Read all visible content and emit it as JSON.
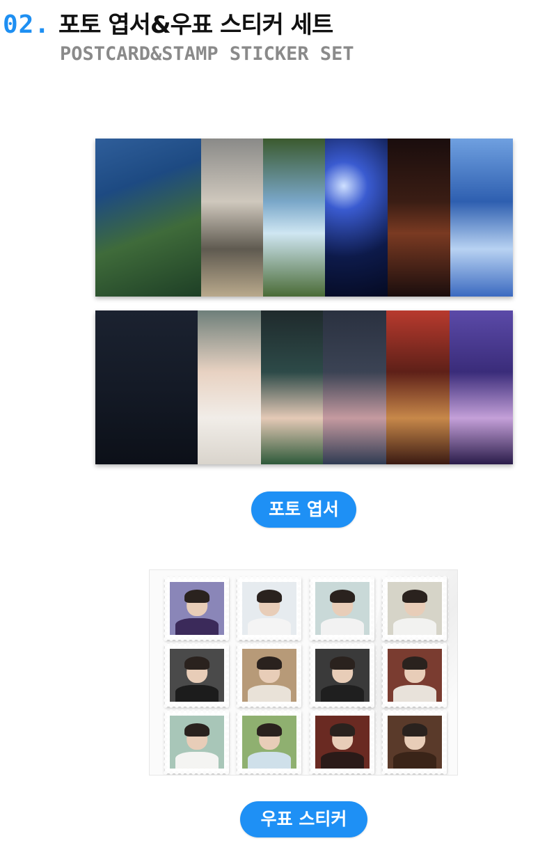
{
  "header": {
    "number": "02.",
    "title": "포토 엽서&우표 스티커 세트",
    "subtitle": "POSTCARD&STAMP STICKER SET"
  },
  "colors": {
    "accent": "#1e90f5",
    "number": "#1e8ff2",
    "subtitle": "#8a8a8a"
  },
  "postcards": {
    "row1": [
      {
        "name": "umbrella-school-photo",
        "bg": "linear-gradient(160deg,#2f5e9a 0%,#1d4a82 30%,#3f6b3a 60%,#1e3f26 100%)"
      },
      {
        "name": "two-students-photo",
        "bg": "linear-gradient(180deg,#8a8a88 0%,#cfc8bd 40%,#5f5a50 70%,#b9a98c 100%)"
      },
      {
        "name": "light-blue-jacket-photo",
        "bg": "linear-gradient(180deg,#3b5a2e 0%,#7aa7c9 40%,#cfe6f2 60%,#4a6b36 100%)"
      },
      {
        "name": "blue-stage-lights-photo",
        "bg": "radial-gradient(circle at 30% 30%,#cfe0ff 0%,#3a5bd0 20%,#0d1a4a 60%,#050a22 100%)"
      },
      {
        "name": "drum-stage-photo",
        "bg": "linear-gradient(180deg,#1a0d0d 0%,#3a1d14 40%,#7a3a22 60%,#1a0d0d 100%)"
      },
      {
        "name": "blue-guitar-photo",
        "bg": "linear-gradient(180deg,#6fa0e0 0%,#2e5fb0 40%,#b8d2f2 70%,#3b6ac0 100%)"
      }
    ],
    "row2": [
      {
        "name": "mic-stage-photo",
        "bg": "linear-gradient(180deg,#1b2230 0%,#141a26 50%,#0c1018 100%)"
      },
      {
        "name": "smiling-girl-photo",
        "bg": "linear-gradient(180deg,#6e7f7a 0%,#e8d2c2 40%,#f1ede8 70%,#d9d4cc 100%)"
      },
      {
        "name": "green-guitar-photo",
        "bg": "linear-gradient(180deg,#1f2a2c 0%,#2d4a48 40%,#e4c9b6 70%,#2e5a3a 100%)"
      },
      {
        "name": "pink-guitar-photo",
        "bg": "linear-gradient(180deg,#2a3140 0%,#3b4354 40%,#c59aa0 70%,#2f3b52 100%)"
      },
      {
        "name": "red-drums-photo",
        "bg": "linear-gradient(180deg,#b83a2e 0%,#5e2018 40%,#c7884a 70%,#3a1a12 100%)"
      },
      {
        "name": "purple-guitar-photo",
        "bg": "linear-gradient(180deg,#5b4aa8 0%,#3a2c7a 40%,#c4a0d8 70%,#2a1c4a 100%)"
      }
    ]
  },
  "pill_postcard": "포토 엽서",
  "stamps": [
    {
      "name": "stamp-1",
      "bg": "#8a86b8",
      "body": "#3b2a5a"
    },
    {
      "name": "stamp-2",
      "bg": "#e6ebef",
      "body": "#f4f4f4"
    },
    {
      "name": "stamp-3",
      "bg": "#c9d9d8",
      "body": "#f2f2f2"
    },
    {
      "name": "stamp-4",
      "bg": "#d6d4c8",
      "body": "#f2f2f0"
    },
    {
      "name": "stamp-5",
      "bg": "#4a4a4a",
      "body": "#1c1c1c"
    },
    {
      "name": "stamp-6",
      "bg": "#b79a78",
      "body": "#e9e2d8"
    },
    {
      "name": "stamp-7",
      "bg": "#3a3a3a",
      "body": "#1f1f1f"
    },
    {
      "name": "stamp-8",
      "bg": "#7a3c30",
      "body": "#e8e2da"
    },
    {
      "name": "stamp-9",
      "bg": "#a8c6b8",
      "body": "#f4f4f2"
    },
    {
      "name": "stamp-10",
      "bg": "#8fb070",
      "body": "#cfe0ea"
    },
    {
      "name": "stamp-11",
      "bg": "#6a2a22",
      "body": "#2a1a18"
    },
    {
      "name": "stamp-12",
      "bg": "#5a3a2a",
      "body": "#3a2418"
    }
  ],
  "pill_stamp": "우표 스티커"
}
